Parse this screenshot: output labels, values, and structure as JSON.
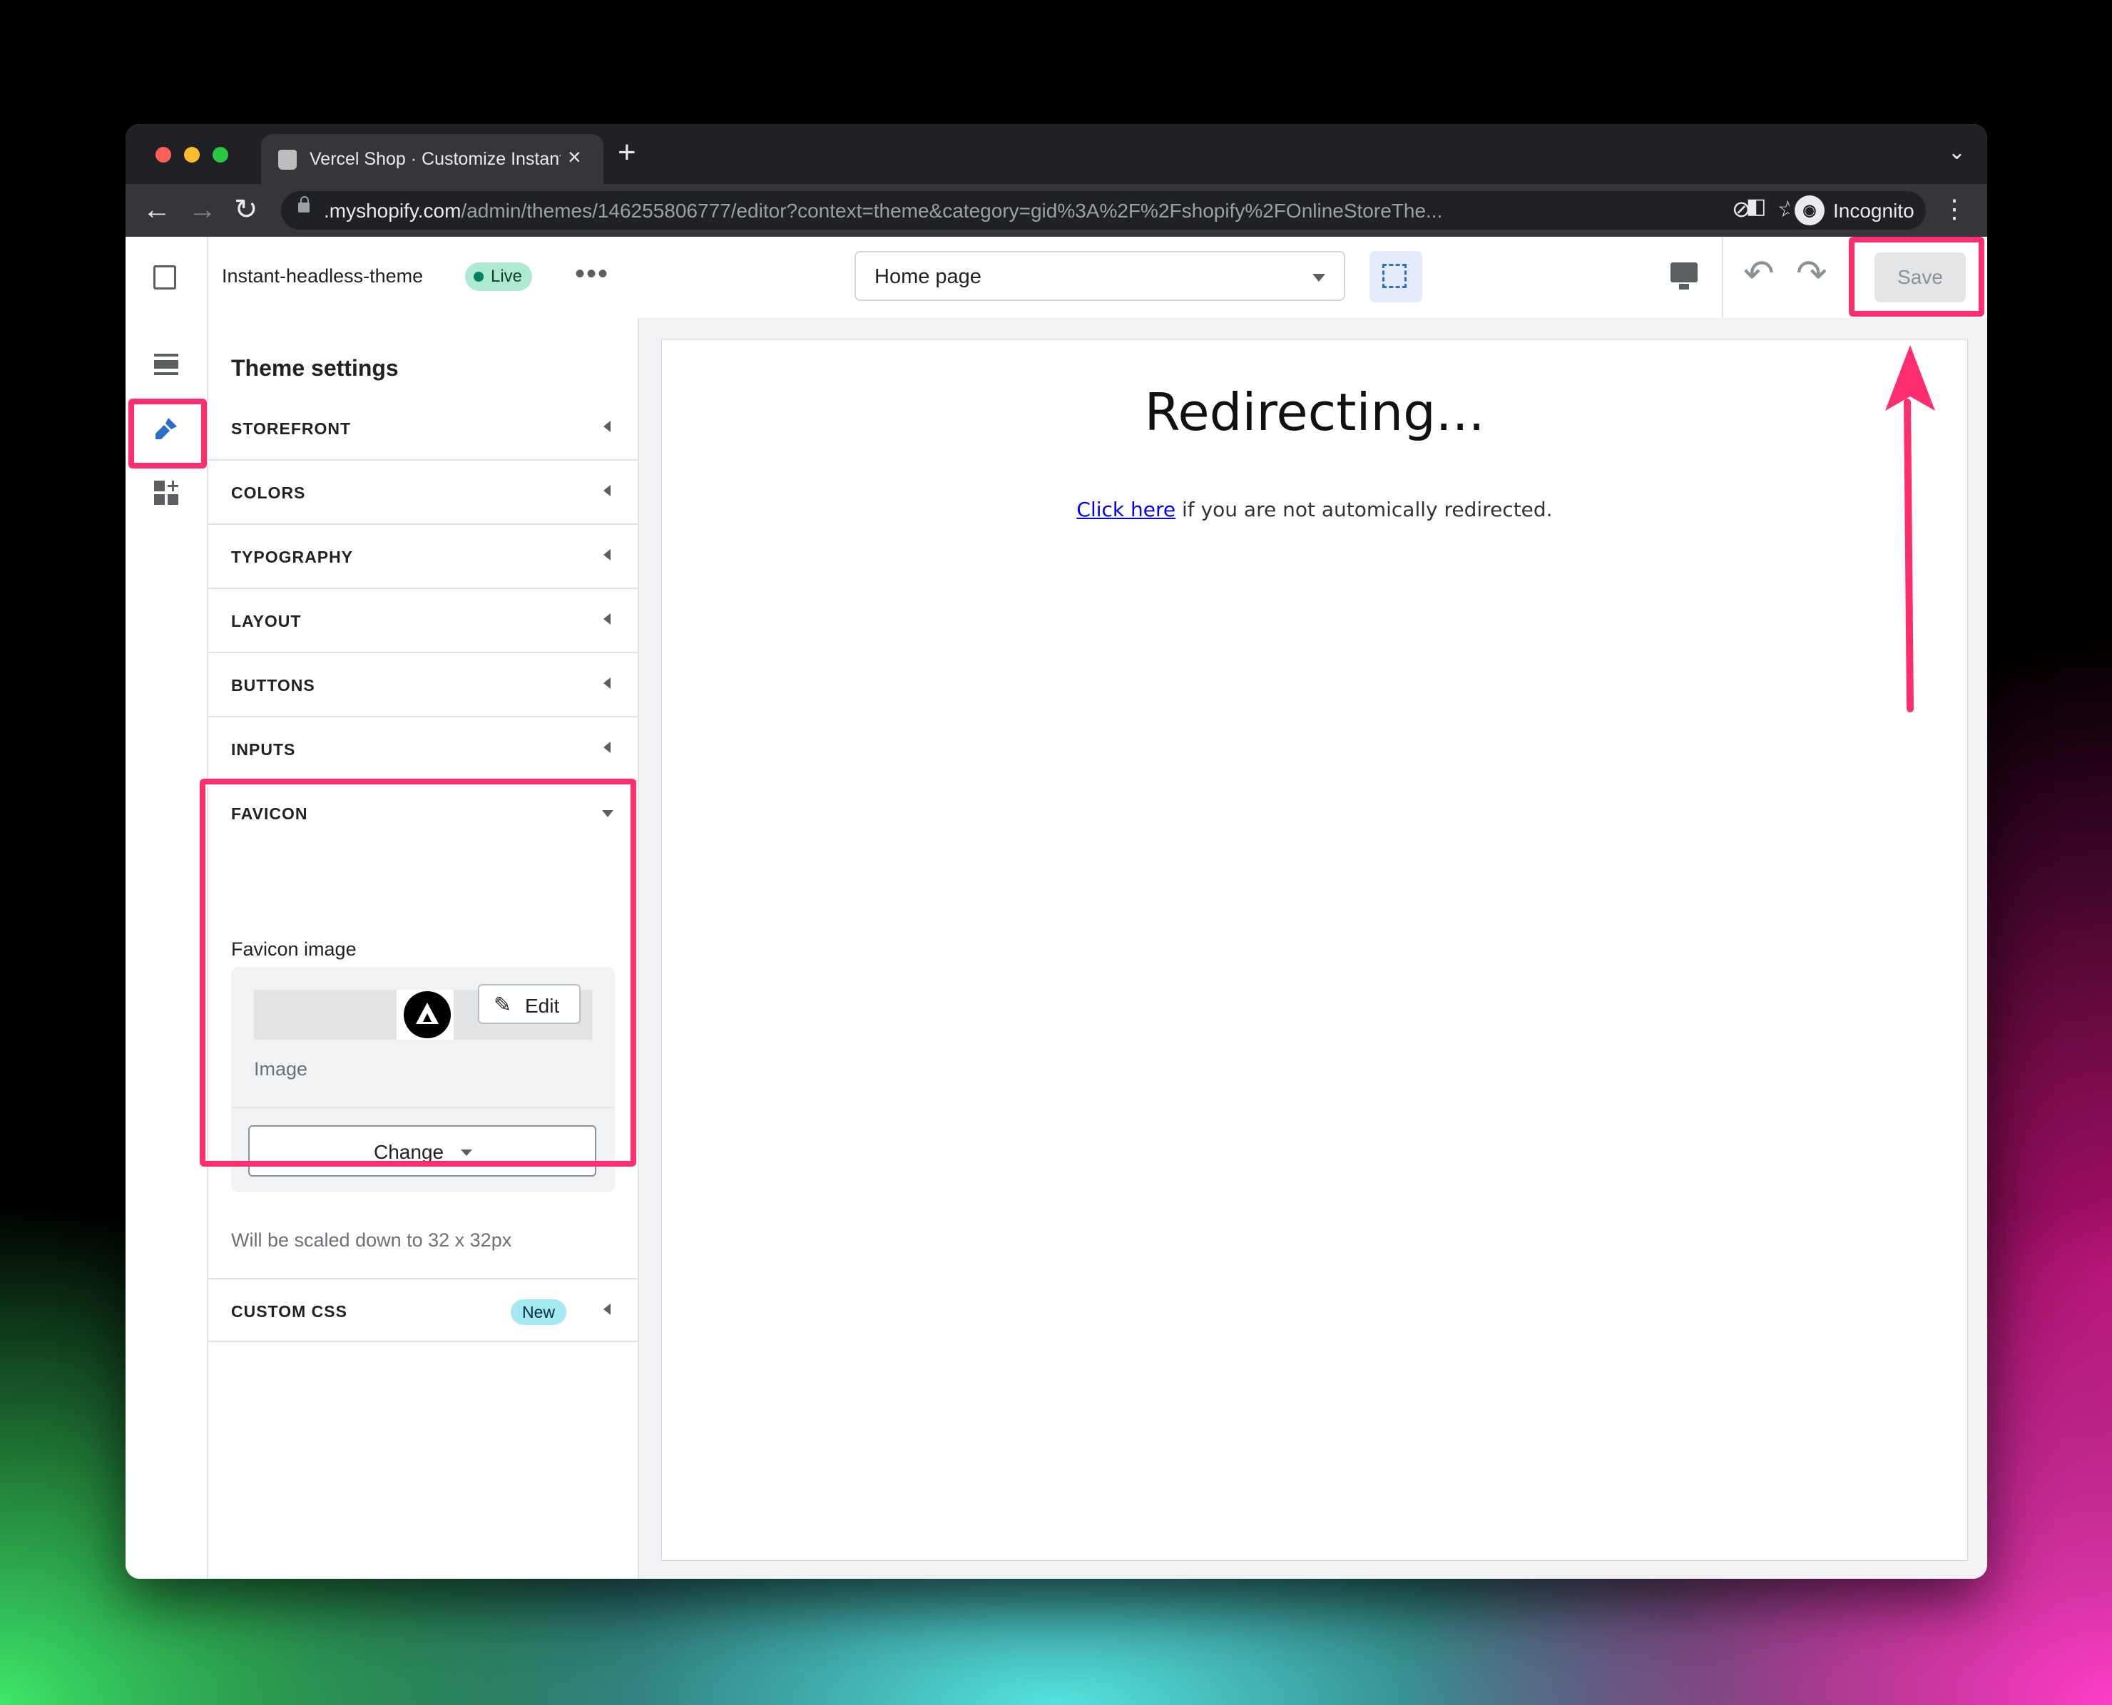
{
  "browser": {
    "traffic_lights": [
      "#ff5f57",
      "#febc2e",
      "#28c840"
    ],
    "tab_title": "Vercel Shop · Customize Instant-headless-theme · Shopify",
    "new_tab_icon": "+",
    "url_host": ".myshopify.com",
    "url_path": "/admin/themes/146255806777/editor?context=theme&category=gid%3A%2F%2Fshopify%2FOnlineStoreThe...",
    "profile_label": "Incognito"
  },
  "header": {
    "theme_name": "Instant-headless-theme",
    "live_badge": "Live",
    "page_select": "Home page",
    "save_label": "Save"
  },
  "sidebar": {
    "title": "Theme settings",
    "sections": [
      {
        "label": "STOREFRONT"
      },
      {
        "label": "COLORS"
      },
      {
        "label": "TYPOGRAPHY"
      },
      {
        "label": "LAYOUT"
      },
      {
        "label": "BUTTONS"
      },
      {
        "label": "INPUTS"
      },
      {
        "label": "FAVICON"
      },
      {
        "label": "CUSTOM CSS",
        "badge": "New"
      }
    ],
    "favicon": {
      "field_label": "Favicon image",
      "edit_label": "Edit",
      "image_label": "Image",
      "change_label": "Change",
      "help_text": "Will be scaled down to 32 x 32px"
    }
  },
  "preview": {
    "title": "Redirecting...",
    "link_text": "Click here",
    "body_text": " if you are not automically redirected."
  },
  "colors": {
    "highlight": "#ff2e6e",
    "live_badge": "#aee9d1",
    "new_badge": "#a4e8f2",
    "accent": "#2c6ecb"
  }
}
